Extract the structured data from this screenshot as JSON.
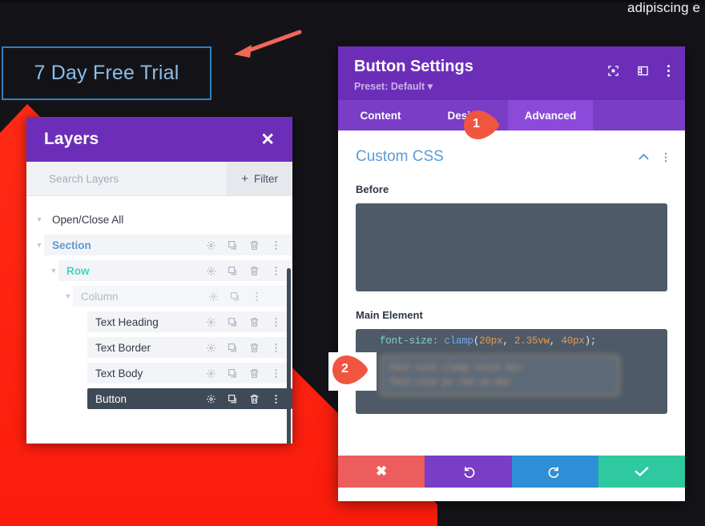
{
  "page": {
    "hero_text": "adipiscing e",
    "trial_button_label": "7 Day Free Trial"
  },
  "layers_panel": {
    "title": "Layers",
    "close_icon": "close-icon",
    "search_placeholder": "Search Layers",
    "filter_label": "Filter",
    "filter_plus": "+",
    "open_close_all": "Open/Close All",
    "rows": [
      {
        "label": "Section",
        "icons": [
          "gear-icon",
          "duplicate-icon",
          "trash-icon",
          "more-icon"
        ]
      },
      {
        "label": "Row",
        "icons": [
          "gear-icon",
          "duplicate-icon",
          "trash-icon",
          "more-icon"
        ]
      },
      {
        "label": "Column",
        "icons": [
          "gear-icon",
          "duplicate-icon",
          "more-icon"
        ]
      },
      {
        "label": "Text Heading",
        "icons": [
          "gear-icon",
          "duplicate-icon",
          "trash-icon",
          "more-icon"
        ]
      },
      {
        "label": "Text Border",
        "icons": [
          "gear-icon",
          "duplicate-icon",
          "trash-icon",
          "more-icon"
        ]
      },
      {
        "label": "Text Body",
        "icons": [
          "gear-icon",
          "duplicate-icon",
          "trash-icon",
          "more-icon"
        ]
      },
      {
        "label": "Button",
        "icons": [
          "gear-icon",
          "duplicate-icon",
          "trash-icon",
          "more-icon"
        ]
      }
    ]
  },
  "settings_modal": {
    "title": "Button Settings",
    "preset": "Preset: Default",
    "header_icons": [
      "focus-icon",
      "layout-icon",
      "more-icon"
    ],
    "tabs": [
      {
        "label": "Content",
        "active": false
      },
      {
        "label": "Design",
        "active": false
      },
      {
        "label": "Advanced",
        "active": true
      }
    ],
    "section": {
      "title": "Custom CSS",
      "collapse_icon": "chevron-up-icon",
      "more_icon": "more-icon"
    },
    "fields": [
      {
        "label": "Before",
        "value": ""
      },
      {
        "label": "Main Element",
        "value": "font-size: clamp(20px, 2.35vw, 40px);"
      }
    ],
    "code_tokens": {
      "property": "font-size:",
      "function": "clamp",
      "open_paren": "(",
      "min": "20px",
      "comma1": ", ",
      "preferred": "2.35vw",
      "comma2": ", ",
      "max": "40px",
      "close": ");"
    },
    "footer": [
      {
        "name": "cancel",
        "icon": "close-icon",
        "color": "#ee5d5d"
      },
      {
        "name": "undo",
        "icon": "undo-icon",
        "color": "#7a3dc6"
      },
      {
        "name": "redo",
        "icon": "redo-icon",
        "color": "#2e8ed6"
      },
      {
        "name": "save",
        "icon": "check-icon",
        "color": "#2fc9a0"
      }
    ]
  },
  "markers": [
    {
      "number": "1"
    },
    {
      "number": "2"
    }
  ],
  "colors": {
    "purple": "#6c2eb9",
    "purple_light": "#8b4ada",
    "red_bg": "#fc2214",
    "marker_orange": "#f05540",
    "code_bg": "#4e5a68",
    "blue_link": "#5b9bd5",
    "teal": "#45d1c4"
  }
}
